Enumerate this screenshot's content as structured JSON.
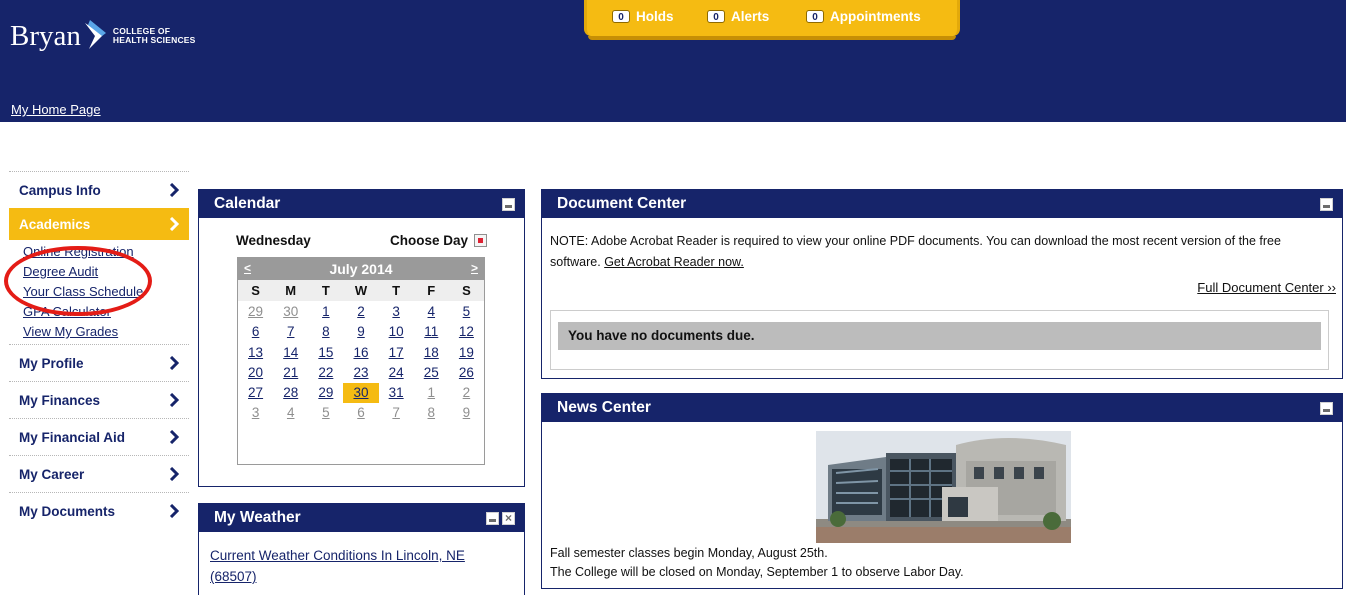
{
  "header": {
    "logo_word": "Bryan",
    "logo_sub_line1": "COLLEGE OF",
    "logo_sub_line2": "HEALTH SCIENCES",
    "home_link": "My Home Page",
    "tabs": [
      {
        "count": "0",
        "label": "Holds"
      },
      {
        "count": "0",
        "label": "Alerts"
      },
      {
        "count": "0",
        "label": "Appointments"
      }
    ],
    "colors": {
      "navy": "#16246a",
      "gold": "#f5bb12"
    }
  },
  "sidebar": {
    "items": [
      {
        "label": "Campus Info"
      },
      {
        "label": "Academics",
        "active": true
      },
      {
        "label": "My Profile"
      },
      {
        "label": "My Finances"
      },
      {
        "label": "My Financial Aid"
      },
      {
        "label": "My Career"
      },
      {
        "label": "My Documents"
      }
    ],
    "academics_links": [
      "Online Registration",
      "Degree Audit",
      "Your Class Schedule",
      "GPA Calculator",
      "View My Grades"
    ]
  },
  "calendar": {
    "title": "Calendar",
    "weekday": "Wednesday",
    "choose_day": "Choose Day",
    "month": "July 2014",
    "prev": "<",
    "next": ">",
    "dow": [
      "S",
      "M",
      "T",
      "W",
      "T",
      "F",
      "S"
    ],
    "weeks": [
      [
        "29",
        "30",
        "1",
        "2",
        "3",
        "4",
        "5"
      ],
      [
        "6",
        "7",
        "8",
        "9",
        "10",
        "11",
        "12"
      ],
      [
        "13",
        "14",
        "15",
        "16",
        "17",
        "18",
        "19"
      ],
      [
        "20",
        "21",
        "22",
        "23",
        "24",
        "25",
        "26"
      ],
      [
        "27",
        "28",
        "29",
        "30",
        "31",
        "1",
        "2"
      ],
      [
        "3",
        "4",
        "5",
        "6",
        "7",
        "8",
        "9"
      ]
    ],
    "today": "30"
  },
  "weather": {
    "title": "My Weather",
    "link": "Current Weather Conditions In Lincoln, NE (68507)"
  },
  "document_center": {
    "title": "Document Center",
    "note": "NOTE: Adobe Acrobat Reader is required to view your online PDF documents. You can download the most recent version of the free software. ",
    "reader_link": "Get Acrobat Reader now.",
    "full_link": "Full Document Center ››",
    "empty_message": "You have no documents due."
  },
  "news_center": {
    "title": "News Center",
    "lines": [
      "Fall semester classes begin Monday, August 25th.",
      "The College will be closed on Monday, September 1 to observe Labor Day."
    ]
  }
}
